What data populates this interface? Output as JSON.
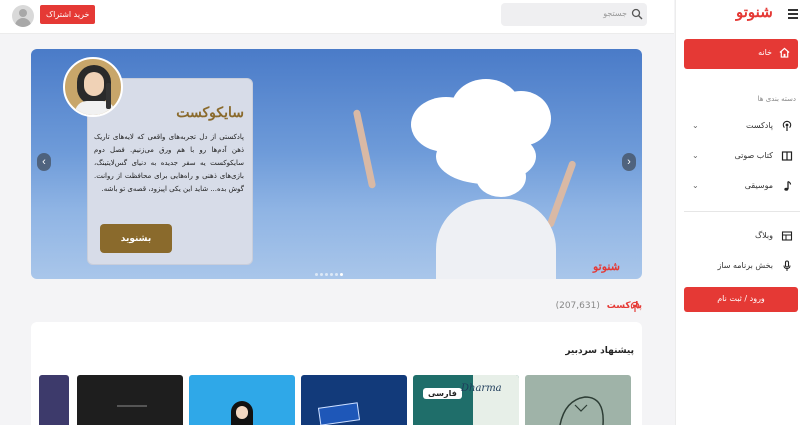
{
  "topbar": {
    "subscribe_label": "خرید اشتراک",
    "search_placeholder": "جستجو"
  },
  "sidebar": {
    "logo": "شنوتو",
    "home_label": "خانه",
    "categories_title": "دسته بندی ها",
    "categories": [
      {
        "label": "پادکست",
        "icon": "podcast-icon"
      },
      {
        "label": "کتاب صوتی",
        "icon": "book-icon"
      },
      {
        "label": "موسیقی",
        "icon": "music-note-icon"
      }
    ],
    "links": [
      {
        "label": "وبلاگ",
        "icon": "blog-icon"
      },
      {
        "label": "بخش برنامه ساز",
        "icon": "microphone-icon"
      }
    ],
    "login_label": "ورود / ثبت نام"
  },
  "banner": {
    "title": "سایکوکست",
    "description": "پادکستی از دل تجربه‌های واقعی که لایه‌های تاریک ذهن آدم‌ها رو با هم ورق می‌زنیم. فصل دوم سایکوکست یه سفر جدیده به دنیای گس‌لایتینگ، بازی‌های ذهنی و راه‌هایی برای محافظت از روانت. گوش بده... شاید این یکی اپیزود، قصه‌ی تو باشه.",
    "cta_label": "بشنوید",
    "watermark": "شنوتو",
    "slide_count": 6,
    "active_slide": 5
  },
  "podcasts": {
    "title": "پادکست",
    "count": "(207,631)"
  },
  "editor_picks": {
    "title": "پیشنهاد سردبیر",
    "thumb_chip": "فارسی",
    "thumb_script": "Dharma"
  },
  "colors": {
    "brand": "#e53935",
    "banner_gold": "#8a6a2c"
  }
}
